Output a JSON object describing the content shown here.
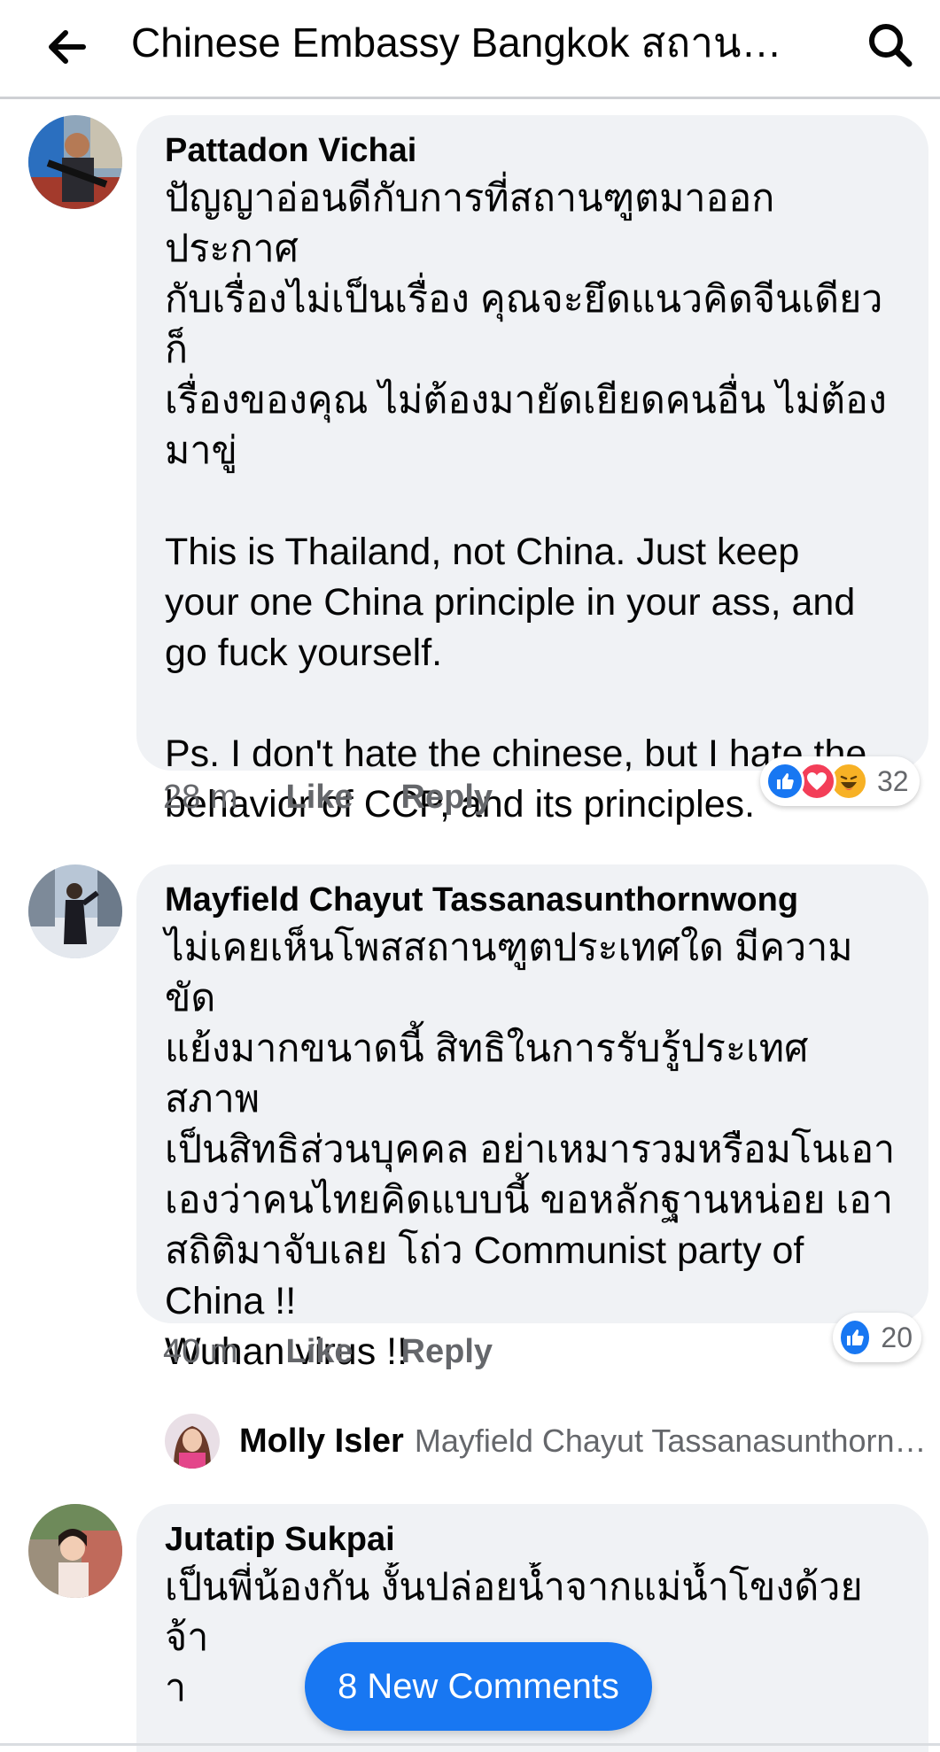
{
  "header": {
    "title": "Chinese Embassy Bangkok สถานเอกอัครราชทูตจีน",
    "back_icon": "arrow-left-icon",
    "search_icon": "search-icon"
  },
  "comments": [
    {
      "author": "Pattadon Vichai",
      "text": "ปัญญาอ่อนดีกับการที่สถานฑูตมาออกประกาศ\nกับเรื่องไม่เป็นเรื่อง คุณจะยึดแนวคิดจีนเดียวก็\nเรื่องของคุณ ไม่ต้องมายัดเยียดคนอื่น ไม่ต้อง\nมาขู่\n\nThis is Thailand, not China. Just keep\nyour one China principle in your ass, and\ngo fuck yourself.\n\nPs. I don't hate the chinese, but I hate the\nbehavior of CCP, and its principles.",
      "time": "28 m",
      "like_label": "Like",
      "reply_label": "Reply",
      "reactions": [
        "like",
        "love",
        "haha"
      ],
      "reaction_count": "32"
    },
    {
      "author": "Mayfield Chayut Tassanasunthornwong",
      "text": "ไม่เคยเห็นโพสสถานฑูตประเทศใด มีความขัด\nแย้งมากขนาดนี้ สิทธิในการรับรู้ประเทศสภาพ\nเป็นสิทธิส่วนบุคคล อย่าเหมารวมหรือมโนเอา\nเองว่าคนไทยคิดแบบนี้ ขอหลักฐานหน่อย เอา\nสถิติมาจับเลย โถ่ว Communist party of\nChina !!\nWuhan virus !!",
      "time": "40 m",
      "like_label": "Like",
      "reply_label": "Reply",
      "reactions": [
        "like"
      ],
      "reaction_count": "20"
    },
    {
      "author": "Jutatip Sukpai",
      "text": "เป็นพี่น้องกัน งั้นปล่อยน้ำจากแม่น้ำโขงด้วยจ้า\nา\n\nYou are still an Communist and"
    }
  ],
  "reply_preview": {
    "author": "Molly Isler",
    "text": "Mayfield Chayut Tassanasunthornwong"
  },
  "new_comments_button": "8 New Comments",
  "colors": {
    "bubble": "#f0f2f5",
    "accent": "#1877f2",
    "love": "#f33e58",
    "haha": "#f7b125",
    "secondary_text": "#65676b"
  }
}
